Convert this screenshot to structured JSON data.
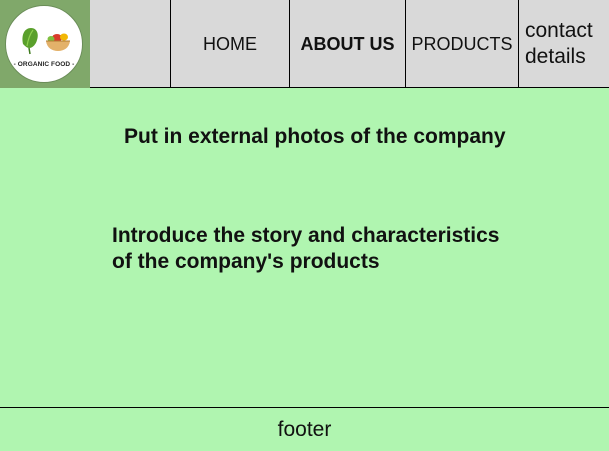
{
  "logo": {
    "text": "- ORGANIC FOOD -"
  },
  "nav": {
    "blank_label": "",
    "home_label": "HOME",
    "about_label": "ABOUT US",
    "products_label": "PRODUCTS",
    "contact_line1": "contact",
    "contact_line2": "details"
  },
  "main": {
    "photos_text": "Put in external photos of the company",
    "story_line1": "Introduce the story and characteristics",
    "story_line2": "of the company's products"
  },
  "footer": {
    "label": "footer"
  },
  "colors": {
    "page_background": "#b0f5b0",
    "header_background": "#d9d9d9",
    "logo_background": "#80a86a"
  }
}
